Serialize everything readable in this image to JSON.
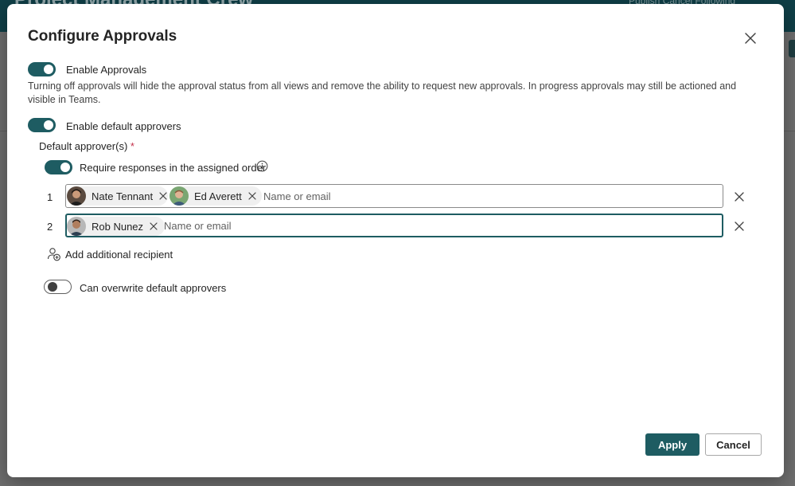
{
  "background": {
    "site_title": "Project Management Crew",
    "header_right": "Publish   Cancel   Following"
  },
  "dialog": {
    "title": "Configure Approvals",
    "close_label": "Close"
  },
  "enable_approvals": {
    "label": "Enable Approvals",
    "on": true,
    "description": "Turning off approvals will hide the approval status from all views and remove the ability to request new approvals. In progress approvals may still be actioned and visible in Teams."
  },
  "enable_default_approvers": {
    "label": "Enable default approvers",
    "on": true
  },
  "default_approvers": {
    "label": "Default approver(s)",
    "required_mark": "*",
    "require_order": {
      "label": "Require responses in the assigned order",
      "on": true
    },
    "rows": [
      {
        "number": "1",
        "people": [
          "Nate Tennant",
          "Ed Averett"
        ],
        "placeholder": "Name or email"
      },
      {
        "number": "2",
        "people": [
          "Rob Nunez"
        ],
        "placeholder": "Name or email"
      }
    ],
    "add_recipient_label": "Add additional recipient"
  },
  "can_overwrite": {
    "label": "Can overwrite default approvers",
    "on": false
  },
  "footer": {
    "apply_label": "Apply",
    "cancel_label": "Cancel"
  },
  "colors": {
    "accent": "#1e5c62",
    "required": "#c4314b"
  }
}
